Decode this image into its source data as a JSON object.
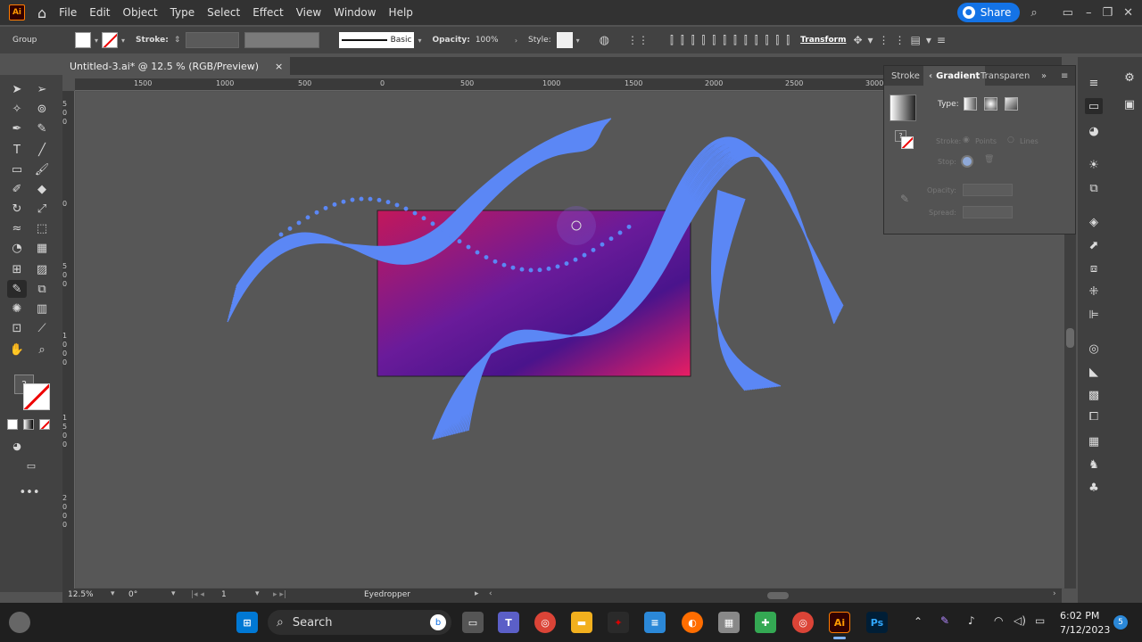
{
  "menubar": {
    "logo": "Ai",
    "items": [
      "File",
      "Edit",
      "Object",
      "Type",
      "Select",
      "Effect",
      "View",
      "Window",
      "Help"
    ],
    "share_label": "Share"
  },
  "control_bar": {
    "selection_label": "Group",
    "stroke_label": "Stroke:",
    "brush_label": "Basic",
    "opacity_label": "Opacity:",
    "opacity_value": "100%",
    "style_label": "Style:",
    "transform_label": "Transform"
  },
  "document": {
    "tab_title": "Untitled-3.ai* @ 12.5 % (RGB/Preview)",
    "close_glyph": "×"
  },
  "ruler": {
    "h_labels": [
      "1500",
      "1000",
      "500",
      "0",
      "500",
      "1000",
      "1500",
      "2000",
      "2500",
      "3000"
    ],
    "v_labels": [
      "5",
      "0",
      "0",
      "0",
      "5",
      "0",
      "0",
      "1",
      "0",
      "0",
      "0",
      "1",
      "5",
      "0",
      "0",
      "2",
      "0",
      "0",
      "0"
    ]
  },
  "gradient_panel": {
    "tabs": [
      "Stroke",
      "Gradient",
      "Transparen"
    ],
    "type_label": "Type:",
    "stroke_label": "Stroke:",
    "stroke_options": [
      "Points",
      "Lines"
    ],
    "stop_label": "Stop:",
    "opacity_label": "Opacity:",
    "spread_label": "Spread:",
    "help_glyph": "?"
  },
  "status_bar": {
    "zoom": "12.5%",
    "rotation": "0°",
    "artboard": "1",
    "tool": "Eyedropper"
  },
  "taskbar": {
    "search_label": "Search",
    "time": "6:02 PM",
    "date": "7/12/2023",
    "badge": "5"
  },
  "colors": {
    "accent": "#1473e6",
    "artwork_lines": "#5b87f5",
    "gradient_a": "#c2185b",
    "gradient_b": "#4a148c"
  },
  "icons": {
    "app_logo": "ai-logo-icon",
    "home": "home-icon",
    "search": "search-icon"
  }
}
